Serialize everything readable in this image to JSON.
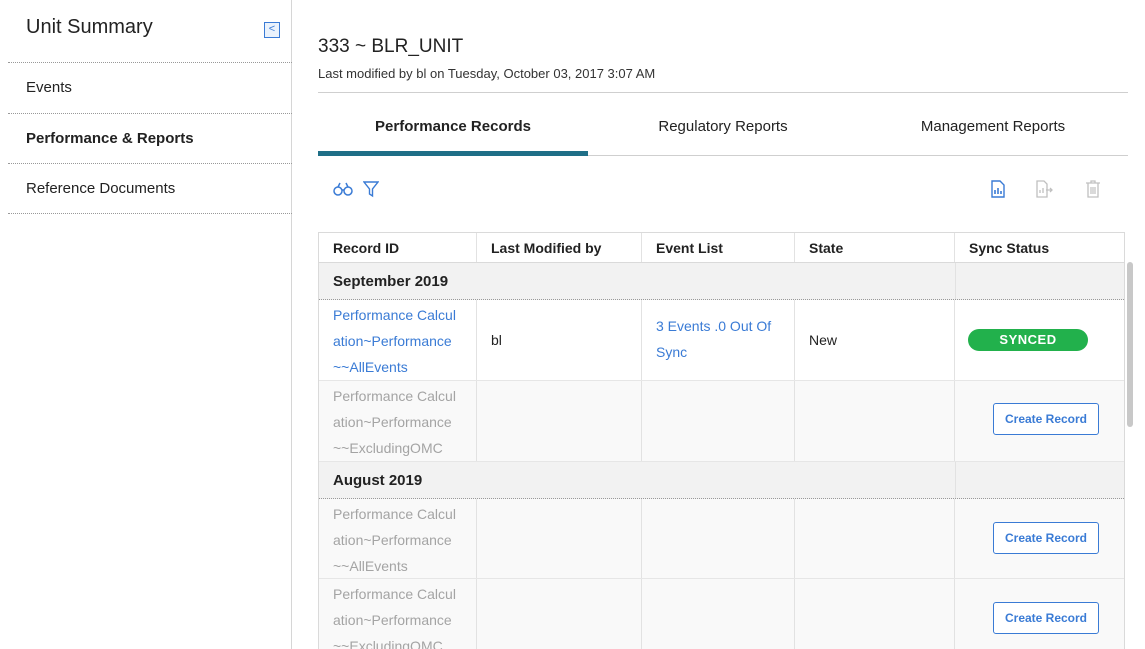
{
  "sidebar": {
    "title": "Unit Summary",
    "collapse_glyph": "<",
    "items": [
      {
        "label": "Events"
      },
      {
        "label": "Performance & Reports",
        "active": true
      },
      {
        "label": "Reference Documents"
      }
    ]
  },
  "header": {
    "title": "333 ~ BLR_UNIT",
    "modified": "Last modified by bl on Tuesday, October 03, 2017 3:07 AM"
  },
  "tabs": [
    {
      "label": "Performance Records",
      "active": true
    },
    {
      "label": "Regulatory Reports"
    },
    {
      "label": "Management Reports"
    }
  ],
  "toolbar": {
    "left_icons": [
      "binoculars-icon",
      "filter-icon"
    ],
    "right_icons": [
      "report-icon",
      "export-icon",
      "delete-icon"
    ]
  },
  "table": {
    "columns": [
      "Record ID",
      "Last Modified by",
      "Event List",
      "State",
      "Sync Status"
    ],
    "groups": [
      {
        "label": "September 2019",
        "rows": [
          {
            "record_id": [
              "Performance Calcul",
              "ation~Performance",
              "~~AllEvents"
            ],
            "last_modified_by": "bl",
            "event_list": [
              "3 Events .0 Out Of",
              "Sync"
            ],
            "state": "New",
            "sync_status": "SYNCED",
            "type": "record"
          },
          {
            "record_id": [
              "Performance Calcul",
              "ation~Performance",
              "~~ExcludingOMC"
            ],
            "action": "Create Record",
            "type": "create"
          }
        ]
      },
      {
        "label": "August 2019",
        "rows": [
          {
            "record_id": [
              "Performance Calcul",
              "ation~Performance",
              "~~AllEvents"
            ],
            "action": "Create Record",
            "type": "create"
          },
          {
            "record_id": [
              "Performance Calcul",
              "ation~Performance",
              "~~ExcludingOMC"
            ],
            "action": "Create Record",
            "type": "create"
          }
        ]
      }
    ]
  },
  "colors": {
    "accent": "#1f6f87",
    "link": "#3a7bd5",
    "synced": "#22b14c",
    "muted": "#a4a4a4"
  }
}
